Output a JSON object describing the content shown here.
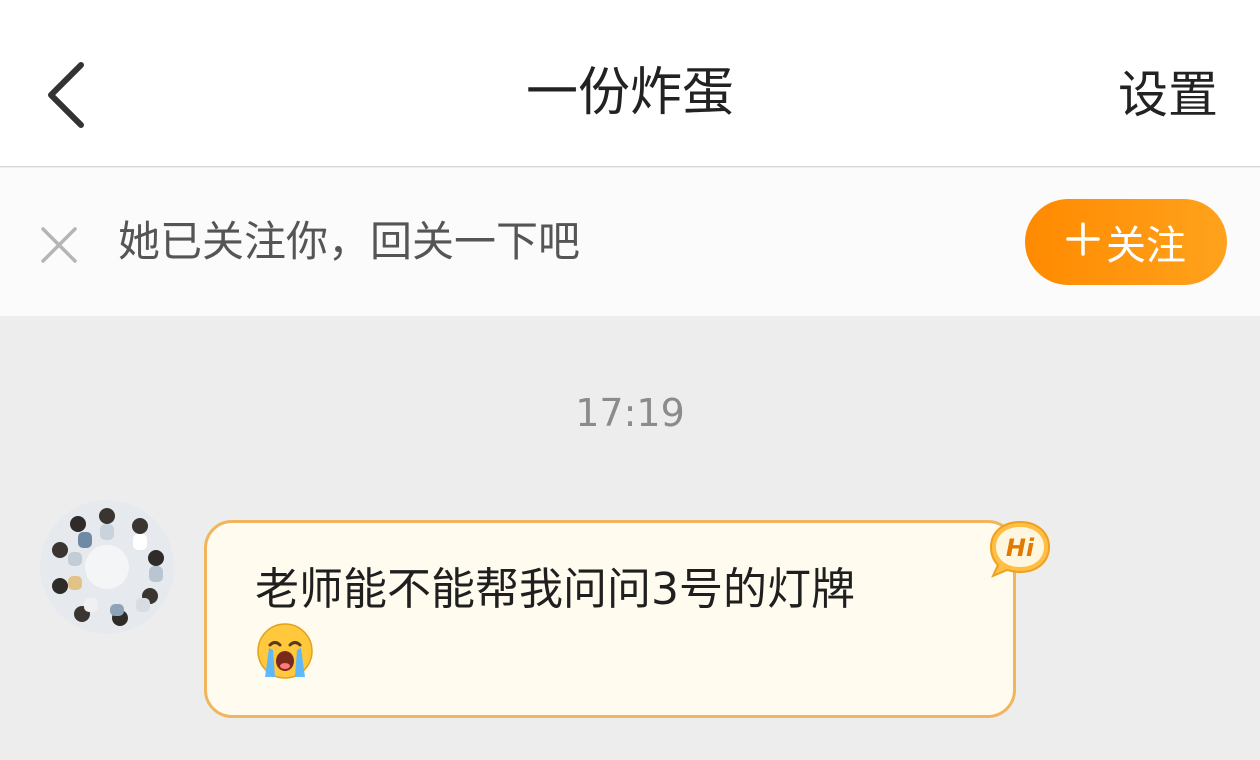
{
  "header": {
    "title": "一份炸蛋",
    "settings_label": "设置"
  },
  "follow_banner": {
    "text": "她已关注你，回关一下吧",
    "button_label": "关注",
    "button_color": "#ff8a00"
  },
  "chat": {
    "timestamp": "17:19",
    "messages": [
      {
        "sender": "other",
        "text": "老师能不能帮我问问3号的灯牌",
        "emoji": "loudly-crying-face",
        "badge": "Hi"
      }
    ]
  },
  "colors": {
    "bubble_border": "#f0b55d",
    "bubble_fill": "#fffbef",
    "background": "#ededed"
  }
}
